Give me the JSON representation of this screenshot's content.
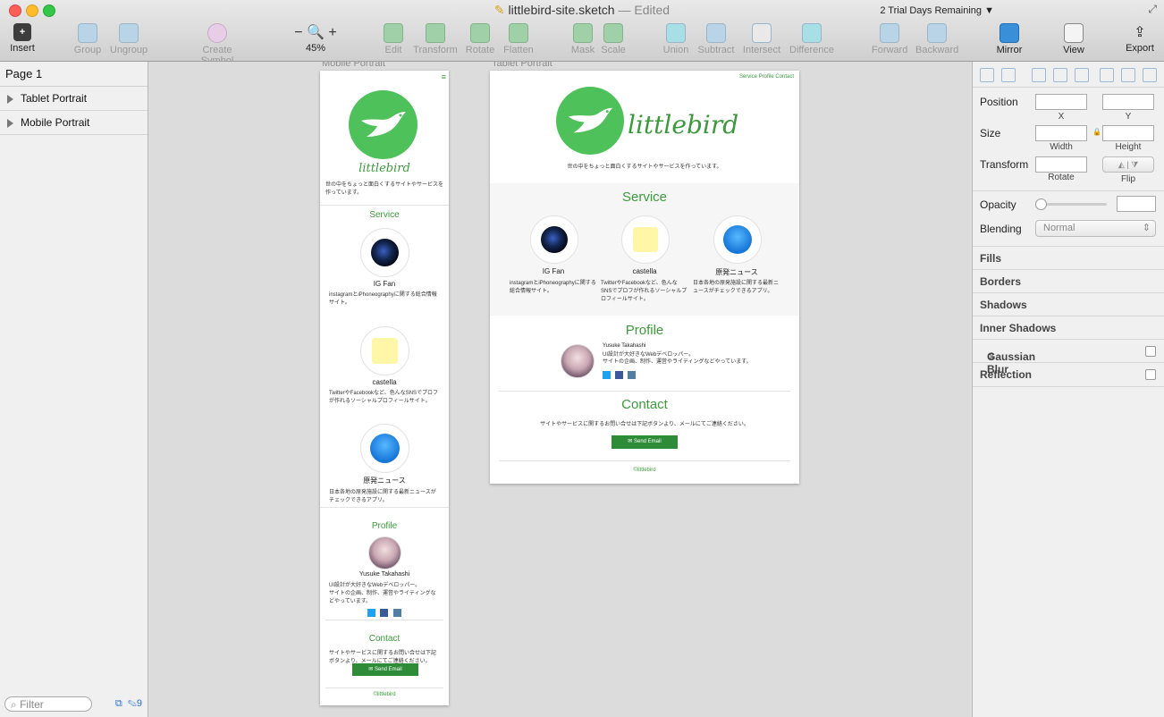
{
  "window": {
    "title": "littlebird-site.sketch",
    "edited": "— Edited",
    "trial": "2 Trial Days Remaining"
  },
  "toolbar": [
    {
      "label": "Insert",
      "icon": "insert-icon",
      "state": "active"
    },
    {
      "label": "Group",
      "icon": "group-icon",
      "state": "disabled"
    },
    {
      "label": "Ungroup",
      "icon": "ungroup-icon",
      "state": "disabled"
    },
    {
      "label": "Create Symbol",
      "icon": "symbol-icon",
      "state": "disabled"
    },
    {
      "label": "45%",
      "icon": "zoom-icon",
      "state": "active"
    },
    {
      "label": "Edit",
      "icon": "edit-icon",
      "state": "disabled"
    },
    {
      "label": "Transform",
      "icon": "transform-icon",
      "state": "disabled"
    },
    {
      "label": "Rotate",
      "icon": "rotate-icon",
      "state": "disabled"
    },
    {
      "label": "Flatten",
      "icon": "flatten-icon",
      "state": "disabled"
    },
    {
      "label": "Mask",
      "icon": "mask-icon",
      "state": "disabled"
    },
    {
      "label": "Scale",
      "icon": "scale-icon",
      "state": "disabled"
    },
    {
      "label": "Union",
      "icon": "union-icon",
      "state": "disabled"
    },
    {
      "label": "Subtract",
      "icon": "subtract-icon",
      "state": "disabled"
    },
    {
      "label": "Intersect",
      "icon": "intersect-icon",
      "state": "disabled"
    },
    {
      "label": "Difference",
      "icon": "difference-icon",
      "state": "disabled"
    },
    {
      "label": "Forward",
      "icon": "forward-icon",
      "state": "disabled"
    },
    {
      "label": "Backward",
      "icon": "backward-icon",
      "state": "disabled"
    },
    {
      "label": "Mirror",
      "icon": "mirror-icon",
      "state": "active"
    },
    {
      "label": "View",
      "icon": "view-icon",
      "state": "active"
    },
    {
      "label": "Export",
      "icon": "export-icon",
      "state": "active"
    }
  ],
  "left_panel": {
    "page": "Page 1",
    "layers": [
      "Tablet Portrait",
      "Mobile Portrait"
    ],
    "filter_placeholder": "Filter",
    "count": "9"
  },
  "artboards": {
    "mobile_label": "Mobile Portrait",
    "tablet_label": "Tablet Portrait"
  },
  "site": {
    "brand": "littlebird",
    "nav": "Service Profile Contact",
    "tagline": "世の中をちょっと面白くするサイトやサービスを作っています。",
    "service_title": "Service",
    "services": [
      {
        "name": "IG Fan",
        "desc": "instagramとiPhoneographyに関する総合情報サイト。"
      },
      {
        "name": "castella",
        "desc": "TwitterやFacebookなど、色んなSNSでプロフが作れるソーシャルプロフィールサイト。"
      },
      {
        "name": "原発ニュース",
        "desc": "日本各地の原発施設に関する最新ニュースがチェックできるアプリ。"
      }
    ],
    "profile_title": "Profile",
    "profile_name": "Yusuke Takahashi",
    "profile_desc1": "UI設計が大好きなWebデベロッパー。",
    "profile_desc2": "サイトの企画、制作、運営やライティングなどやっています。",
    "contact_title": "Contact",
    "contact_desc": "サイトやサービスに関するお問い合せは下記ボタンより、メールにてご連絡ください。",
    "send_email": "Send Email",
    "footer": "©littlebird"
  },
  "inspector": {
    "position": "Position",
    "x": "X",
    "y": "Y",
    "size": "Size",
    "width": "Width",
    "height": "Height",
    "transform": "Transform",
    "rotate": "Rotate",
    "flip": "Flip",
    "opacity": "Opacity",
    "blending": "Blending",
    "blending_value": "Normal",
    "sections": [
      "Fills",
      "Borders",
      "Shadows",
      "Inner Shadows",
      "Gaussian Blur",
      "Reflection"
    ]
  },
  "colors": {
    "brand_green": "#4ec15a",
    "text_green": "#3b9a3b",
    "button_green": "#2e8b37"
  }
}
